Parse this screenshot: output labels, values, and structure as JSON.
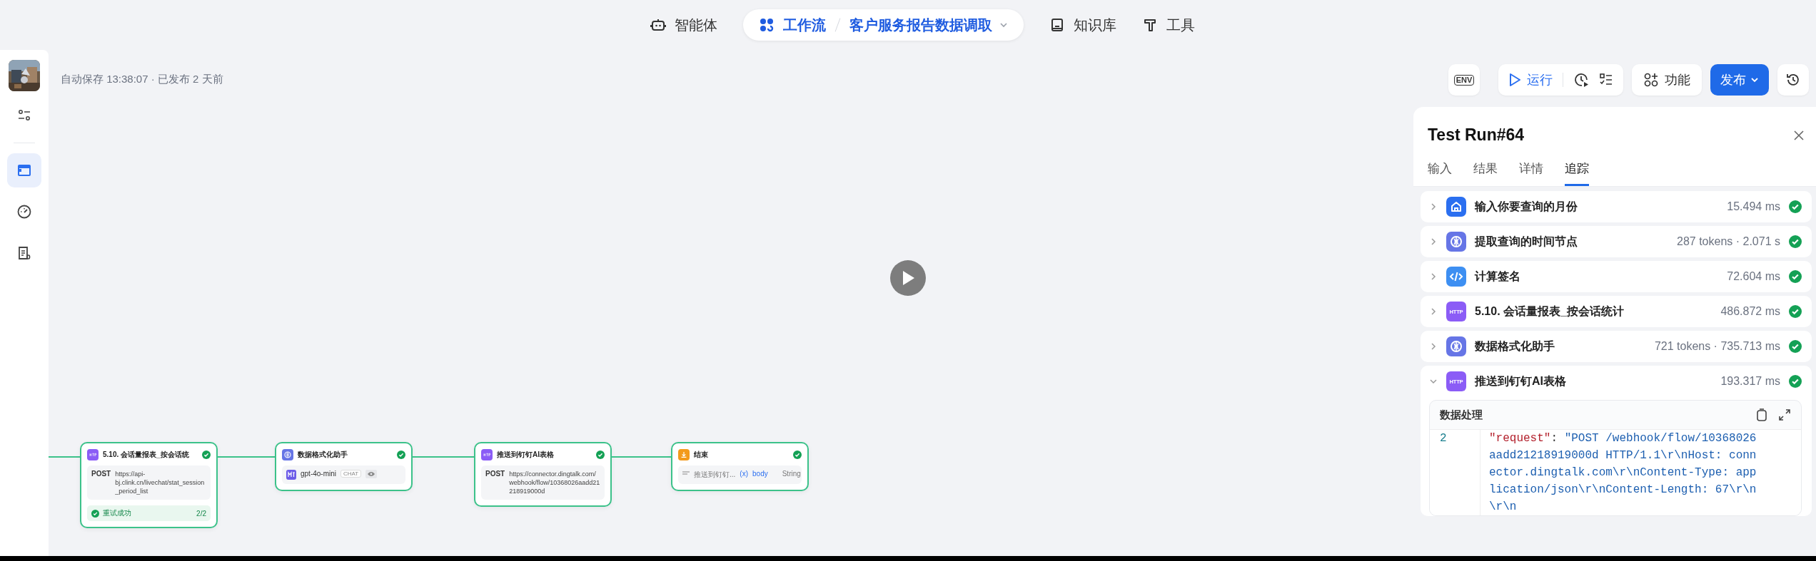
{
  "top_nav": {
    "items": [
      {
        "kind": "agent",
        "label": "智能体",
        "selected": false
      },
      {
        "kind": "workflow",
        "label": "工作流",
        "selected": true,
        "breadcrumb": "客户服务报告数据调取"
      },
      {
        "kind": "knowledge",
        "label": "知识库",
        "selected": false
      },
      {
        "kind": "tools",
        "label": "工具",
        "selected": false
      }
    ]
  },
  "sidebar": {
    "items": [
      {
        "kind": "settings",
        "selected": false
      },
      {
        "kind": "window",
        "selected": true
      },
      {
        "kind": "gauge",
        "selected": false
      },
      {
        "kind": "doc",
        "selected": false
      }
    ]
  },
  "save_status": "自动保存 13:38:07 · 已发布 2 天前",
  "toolbar": {
    "env_label": "ENV",
    "run_label": "运行",
    "feature_label": "功能",
    "publish_label": "发布"
  },
  "canvas": {
    "nodes": [
      {
        "kind": "http",
        "title": "5.10. 会话量报表_按会话统",
        "success": true,
        "method": "POST",
        "url": "https://api-bj.clink.cn/livechat/stat_session_period_list",
        "footer": "重试成功",
        "footer_count": "2/2"
      },
      {
        "kind": "llm",
        "title": "数据格式化助手",
        "success": true,
        "model": "gpt-4o-mini",
        "model_tag": "CHAT"
      },
      {
        "kind": "http",
        "title": "推送到钉钉AI表格",
        "success": true,
        "method": "POST",
        "url": "https://connector.dingtalk.com/webhook/flow/10368026aadd21218919000d"
      },
      {
        "kind": "end",
        "title": "结束",
        "success": true,
        "var_source": "推送到钉钉...",
        "var_marker": "(x)",
        "var_name": "body",
        "var_type": "String"
      }
    ]
  },
  "run_panel": {
    "title": "Test Run#64",
    "tabs": [
      {
        "label": "输入",
        "selected": false
      },
      {
        "label": "结果",
        "selected": false
      },
      {
        "label": "详情",
        "selected": false
      },
      {
        "label": "追踪",
        "selected": true
      }
    ],
    "trace": [
      {
        "kind": "start",
        "name": "输入你要查询的月份",
        "metric": "15.494 ms",
        "success": true,
        "expanded": false
      },
      {
        "kind": "llm",
        "name": "提取查询的时间节点",
        "metric": "287 tokens · 2.071 s",
        "success": true,
        "expanded": false
      },
      {
        "kind": "code",
        "name": "计算签名",
        "metric": "72.604 ms",
        "success": true,
        "expanded": false
      },
      {
        "kind": "http",
        "icon_text": "HTTP",
        "name": "5.10. 会话量报表_按会话统计",
        "metric": "486.872 ms",
        "success": true,
        "expanded": false
      },
      {
        "kind": "llm",
        "name": "数据格式化助手",
        "metric": "721 tokens · 735.713 ms",
        "success": true,
        "expanded": false
      },
      {
        "kind": "http",
        "icon_text": "HTTP",
        "name": "推送到钉钉AI表格",
        "metric": "193.317 ms",
        "success": true,
        "expanded": true,
        "detail": {
          "title": "数据处理",
          "line_number": "2",
          "code": [
            {
              "kind": "key",
              "text": "\"request\""
            },
            {
              "kind": "punct",
              "text": ": "
            },
            {
              "kind": "string",
              "text": "\"POST /webhook/flow/10368026aadd21218919000d HTTP/1.1\\r\\nHost: connector.dingtalk.com\\r\\nContent-Type: application/json\\r\\nContent-Length: 67\\r\\n\\r\\n"
            }
          ]
        }
      }
    ]
  }
}
